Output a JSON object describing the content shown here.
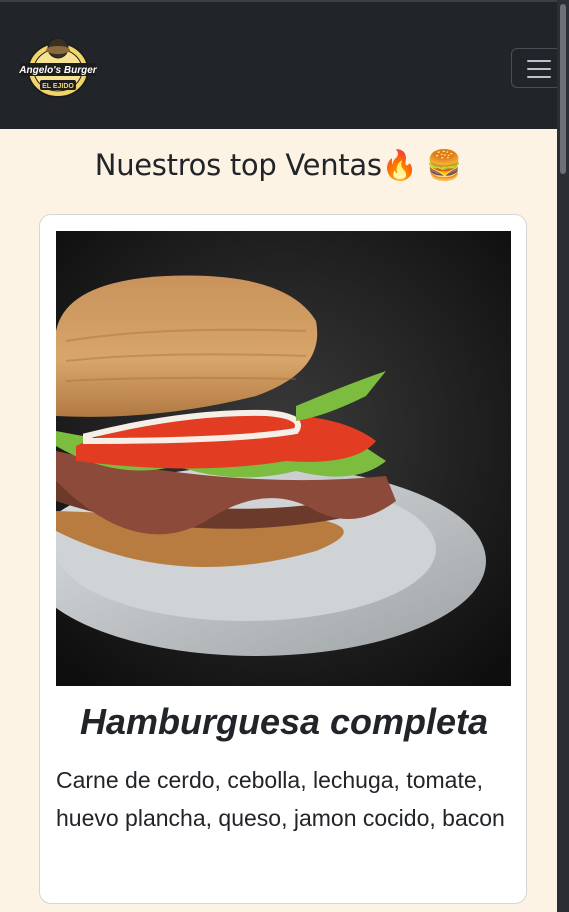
{
  "navbar": {
    "logo_line1": "Angelo's Burger",
    "logo_line2": "EL EJIDO"
  },
  "section": {
    "title": "Nuestros top Ventas🔥 🍔"
  },
  "card": {
    "title": "Hamburguesa completa",
    "description": "Carne de cerdo, cebolla, lechuga, tomate, huevo plancha, queso, jamon cocido, bacon"
  },
  "colors": {
    "navbar_bg": "#212529",
    "page_bg": "#fdf3e4"
  }
}
